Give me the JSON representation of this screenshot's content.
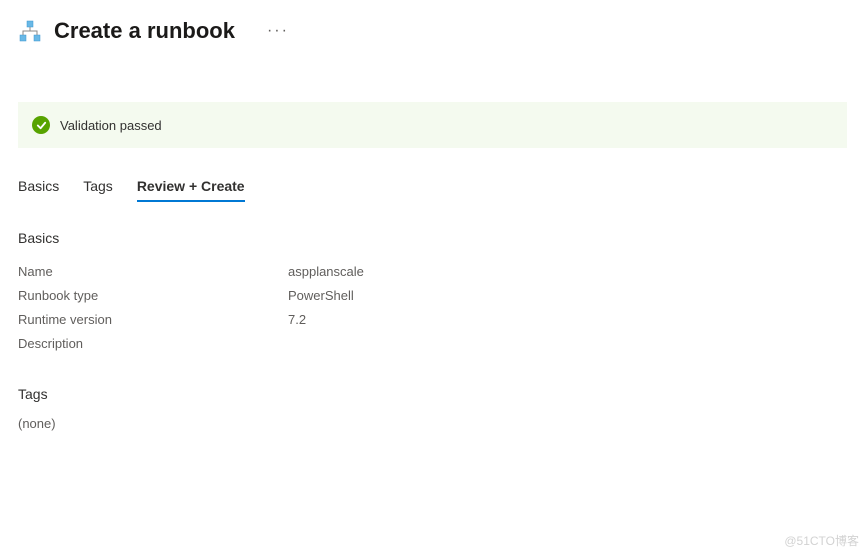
{
  "header": {
    "title": "Create a runbook",
    "more_label": "···"
  },
  "validation": {
    "message": "Validation passed"
  },
  "tabs": [
    {
      "label": "Basics",
      "active": false
    },
    {
      "label": "Tags",
      "active": false
    },
    {
      "label": "Review + Create",
      "active": true
    }
  ],
  "sections": {
    "basics": {
      "title": "Basics",
      "rows": [
        {
          "label": "Name",
          "value": "aspplanscale"
        },
        {
          "label": "Runbook type",
          "value": "PowerShell"
        },
        {
          "label": "Runtime version",
          "value": "7.2"
        },
        {
          "label": "Description",
          "value": ""
        }
      ]
    },
    "tags": {
      "title": "Tags",
      "none_label": "(none)"
    }
  },
  "watermark": "@51CTO博客"
}
